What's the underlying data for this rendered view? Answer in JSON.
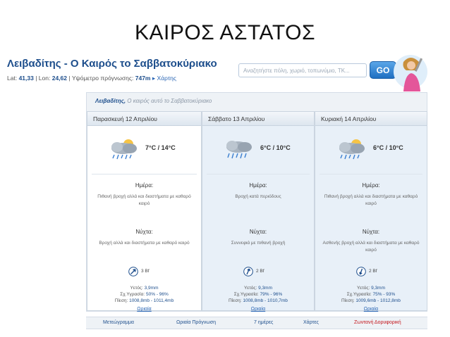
{
  "slide_title": "ΚΑΙΡΟΣ ΑΣΤΑΤΟΣ",
  "site": {
    "title": "Λειβαδίτης - Ο Καιρός το Σαββατοκύριακο",
    "coords_lat_label": "Lat:",
    "lat": "41,33",
    "lon_label": "| Lon:",
    "lon": "24,62",
    "alt_label": "| Υψόμετρο πρόγνωσης:",
    "altitude": "747m",
    "map_link": "Χάρτης",
    "search_placeholder": "Αναζητήστε πόλη, χωριό, τοπωνύμιο, ΤΚ...",
    "go_label": "GO"
  },
  "panel": {
    "place": "Λειβαδίτης,",
    "subtitle": "Ο καιρός αυτό το Σαββατοκύριακο"
  },
  "days": [
    {
      "header": "Παρασκευή 12 Απριλίου",
      "temp": "7°C / 14°C",
      "day_label": "Ημέρα:",
      "day_text": "Πιθανή βροχή αλλά και διαστήματα με καθαρό καιρό",
      "night_label": "Νύχτα:",
      "night_text": "Βροχή αλλά και διαστήματα με καθαρό καιρό",
      "wind": "3 Bf",
      "rain_label": "Υετός:",
      "rain": "3,9mm",
      "humidity_label": "Σχ.Υγρασία:",
      "humidity": "50% - 96%",
      "pressure_label": "Πίεση:",
      "pressure": "1008,8mb - 1011,4mb",
      "hourly": "Ωριαία"
    },
    {
      "header": "Σάββατο 13 Απριλίου",
      "temp": "6°C / 10°C",
      "day_label": "Ημέρα:",
      "day_text": "Βροχή κατά περιόδους",
      "night_label": "Νύχτα:",
      "night_text": "Συννεφιά με πιθανή βροχή",
      "wind": "2 Bf",
      "rain_label": "Υετός:",
      "rain": "9,3mm",
      "humidity_label": "Σχ.Υγρασία:",
      "humidity": "79% - 96%",
      "pressure_label": "Πίεση:",
      "pressure": "1008,8mb - 1010,7mb",
      "hourly": "Ωριαία"
    },
    {
      "header": "Κυριακή 14 Απριλίου",
      "temp": "6°C / 10°C",
      "day_label": "Ημέρα:",
      "day_text": "Πιθανή βροχή αλλά και διαστήματα με καθαρό καιρό",
      "night_label": "Νύχτα:",
      "night_text": "Ασθενής βροχή αλλά και διαστήματα με καθαρό καιρό",
      "wind": "2 Bf",
      "rain_label": "Υετός:",
      "rain": "9,3mm",
      "humidity_label": "Σχ.Υγρασία:",
      "humidity": "75% - 93%",
      "pressure_label": "Πίεση:",
      "pressure": "1009,6mb - 1012,8mb",
      "hourly": "Ωριαία"
    }
  ],
  "nav": {
    "meteogram": "Μετεώγραμμα",
    "hourly_forecast": "Ωριαία Πρόγνωση",
    "seven_days": "7 ημέρες",
    "maps": "Χάρτες",
    "satellite": "Ζωντανή Δορυφορική"
  },
  "colors": {
    "brand": "#1d4e8c",
    "go_button": "#1f6fc2",
    "live_link": "#c3141a"
  },
  "icons": [
    "rain-cloud-icon",
    "wind-arrow-icon",
    "map-pin-icon"
  ]
}
